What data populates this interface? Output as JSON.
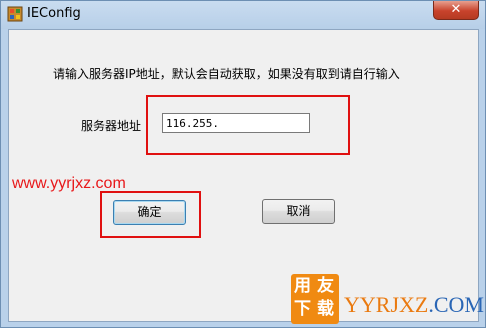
{
  "window": {
    "title": "IEConfig",
    "close_label": "✕"
  },
  "dialog": {
    "prompt": "请输入服务器IP地址，默认会自动获取，如果没有取到请自行输入",
    "server_label": "服务器地址",
    "ip_value": "116.255.",
    "ok_label": "确定",
    "cancel_label": "取消"
  },
  "watermark": {
    "url": "www.yyrjxz.com",
    "logo_chars": [
      "用",
      "友",
      "下",
      "载"
    ],
    "brand_main": "YYRJXZ",
    "brand_dot": ".",
    "brand_tld": "COM"
  },
  "colors": {
    "highlight_box": "#e01010",
    "watermark_red": "#e8181a",
    "watermark_orange": "#f08a12",
    "watermark_blue": "#2a66b5"
  },
  "icons": {
    "app": "ieconfig-app-icon",
    "close": "close-icon"
  }
}
